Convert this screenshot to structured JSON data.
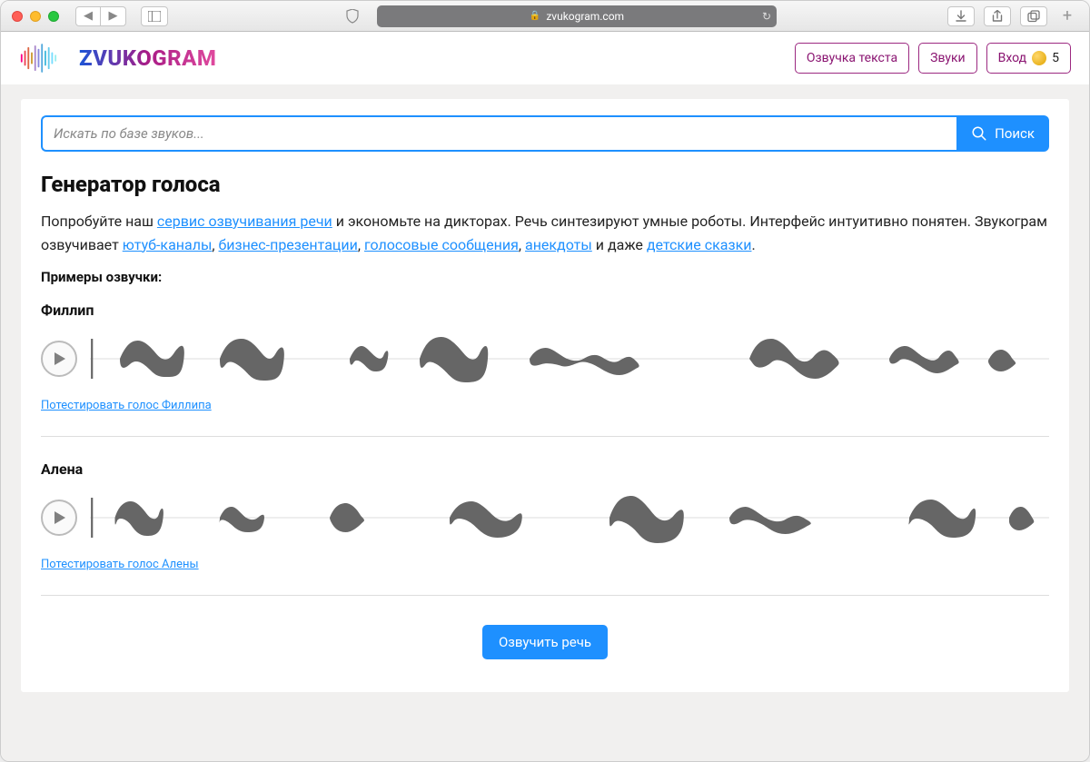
{
  "browser": {
    "url_host": "zvukogram.com"
  },
  "header": {
    "brand": "ZVUKOGRAM",
    "nav": {
      "voice": "Озвучка текста",
      "sounds": "Звуки",
      "login": "Вход",
      "credits": "5"
    }
  },
  "search": {
    "placeholder": "Искать по базе звуков...",
    "button": "Поиск"
  },
  "page": {
    "title": "Генератор голоса",
    "intro_prefix": "Попробуйте наш ",
    "intro_link1": "сервис озвучивания речи",
    "intro_mid1": " и экономьте на дикторах. Речь синтезируют умные роботы. Интерфейс интуитивно понятен. Звукограм озвучивает ",
    "intro_link2": "ютуб-каналы",
    "intro_sep": ", ",
    "intro_link3": "бизнес-презентации",
    "intro_link4": "голосовые сообщения",
    "intro_link5": "анекдоты",
    "intro_mid2": " и даже ",
    "intro_link6": "детские сказки",
    "intro_end": ".",
    "examples_label": "Примеры озвучки:",
    "voices": [
      {
        "name": "Филлип",
        "test": "Потестировать голос Филлипа"
      },
      {
        "name": "Алена",
        "test": "Потестировать голос Алены"
      }
    ],
    "cta": "Озвучить речь"
  }
}
